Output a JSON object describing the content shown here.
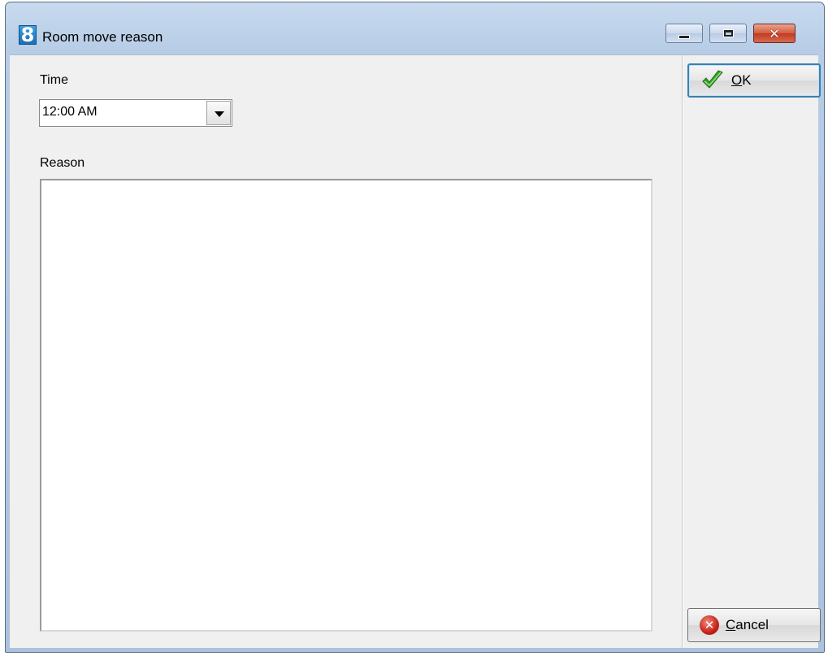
{
  "window": {
    "title": "Room move reason",
    "app_icon_glyph": "8",
    "controls": {
      "minimize": "minimize",
      "maximize": "maximize",
      "close": "✕"
    }
  },
  "form": {
    "time_label": "Time",
    "time_value": "12:00 AM",
    "reason_label": "Reason",
    "reason_value": ""
  },
  "buttons": {
    "ok_label": "OK",
    "ok_mnemonic": "O",
    "ok_rest": "K",
    "cancel_label": "Cancel",
    "cancel_mnemonic": "C",
    "cancel_rest": "ancel",
    "cancel_icon_glyph": "✕"
  },
  "colors": {
    "ok_focus_border": "#3c7fb1",
    "check_green": "#3aa12c",
    "cancel_red": "#c4221a"
  }
}
